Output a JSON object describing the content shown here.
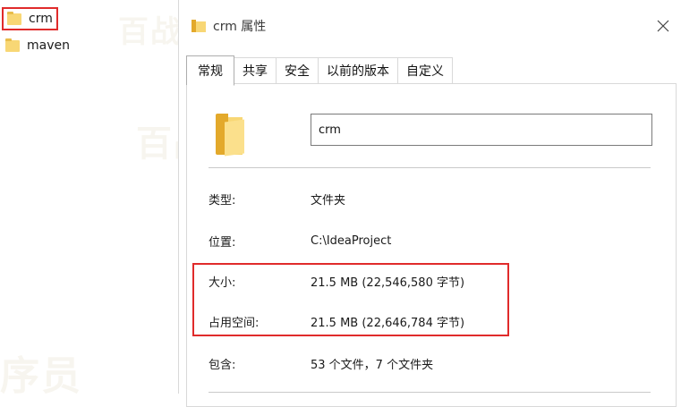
{
  "explorer": {
    "items": [
      {
        "label": "crm",
        "selected": true
      },
      {
        "label": "maven",
        "selected": false
      }
    ]
  },
  "dialog": {
    "title": "crm 属性",
    "close_icon": "close-icon",
    "tabs": [
      {
        "label": "常规",
        "active": true
      },
      {
        "label": "共享"
      },
      {
        "label": "安全"
      },
      {
        "label": "以前的版本"
      },
      {
        "label": "自定义"
      }
    ],
    "name_value": "crm",
    "properties": {
      "type": {
        "label": "类型:",
        "value": "文件夹"
      },
      "location": {
        "label": "位置:",
        "value": "C:\\IdeaProject"
      },
      "size": {
        "label": "大小:",
        "value": "21.5 MB (22,546,580 字节)"
      },
      "size_on_disk": {
        "label": "占用空间:",
        "value": "21.5 MB (22,646,784 字节)"
      },
      "contains": {
        "label": "包含:",
        "value": "53 个文件，7 个文件夹"
      }
    }
  },
  "watermark": {
    "text_1": "百战程序员",
    "text_2": "百战程序员",
    "text_3": "序员",
    "text_4": "百战程序员"
  },
  "colors": {
    "highlight": "#e02b2b",
    "folder": "#f8d775",
    "folder_dark": "#e3a92b"
  }
}
